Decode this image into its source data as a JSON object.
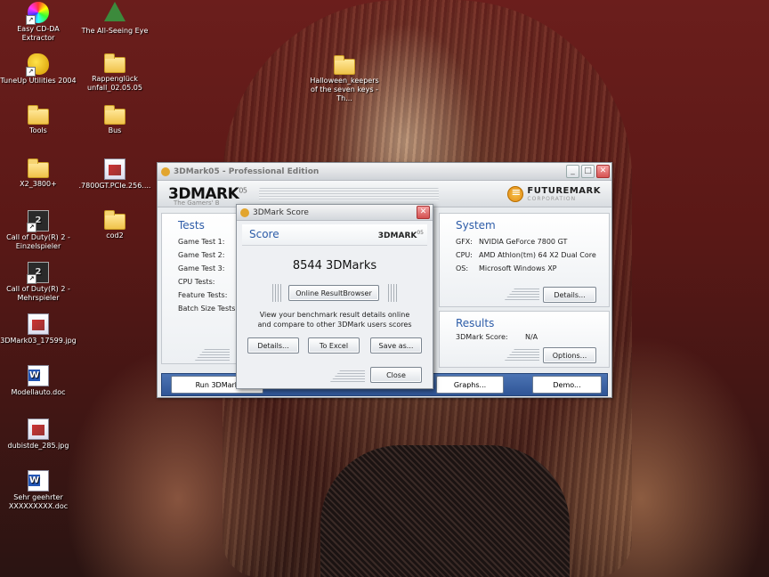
{
  "desktop": {
    "icons": [
      {
        "label": "Easy CD-DA Extractor",
        "icon": "cd-icon"
      },
      {
        "label": "The All-Seeing Eye",
        "icon": "eye-icon"
      },
      {
        "label": "TuneUp Utilities 2004",
        "icon": "tuneup-icon"
      },
      {
        "label": "Rappenglück unfall_02.05.05",
        "icon": "folder-icon"
      },
      {
        "label": "Tools",
        "icon": "folder-icon"
      },
      {
        "label": "Bus",
        "icon": "folder-icon"
      },
      {
        "label": "X2_3800+",
        "icon": "folder-icon"
      },
      {
        "label": ".7800GT.PCIe.256....",
        "icon": "file-icon"
      },
      {
        "label": "Call of Duty(R) 2 - Einzelspieler",
        "icon": "cod-icon"
      },
      {
        "label": "cod2",
        "icon": "folder-icon"
      },
      {
        "label": "Call of Duty(R) 2 - Mehrspieler",
        "icon": "cod-icon"
      },
      {
        "label": "3DMark03_17599.jpg",
        "icon": "image-icon"
      },
      {
        "label": "Modellauto.doc",
        "icon": "word-doc-icon"
      },
      {
        "label": "dubistde_285.jpg",
        "icon": "image-icon"
      },
      {
        "label": "Sehr geehrter XXXXXXXXX.doc",
        "icon": "word-doc-icon"
      },
      {
        "label": "Halloween_keepers of the seven keys -Th...",
        "icon": "folder-icon"
      }
    ]
  },
  "main_window": {
    "title": "3DMark05 - Professional Edition",
    "logo": "3DMARK",
    "logo_suffix": "05",
    "tagline": "The Gamers' B",
    "brand": "FUTUREMARK",
    "brand_sub": "CORPORATION",
    "tests": {
      "heading": "Tests",
      "items": [
        "Game Test 1:",
        "Game Test 2:",
        "Game Test 3:",
        "CPU Tests:",
        "Feature Tests:",
        "Batch Size Tests:"
      ]
    },
    "system": {
      "heading": "System",
      "rows": [
        {
          "key": "GFX:",
          "value": "NVIDIA GeForce 7800 GT"
        },
        {
          "key": "CPU:",
          "value": "AMD Athlon(tm) 64 X2 Dual Core"
        },
        {
          "key": "OS:",
          "value": "Microsoft Windows XP"
        }
      ],
      "details_label": "Details..."
    },
    "results": {
      "heading": "Results",
      "score_key": "3DMark Score:",
      "score_value": "N/A",
      "options_label": "Options..."
    },
    "bottom": {
      "run_label": "Run 3DMark",
      "graphs_label": "Graphs...",
      "demo_label": "Demo..."
    }
  },
  "score_dialog": {
    "title": "3DMark Score",
    "header": "Score",
    "logo": "3DMARK",
    "logo_suffix": "05",
    "score": "8544 3DMarks",
    "online_label": "Online ResultBrowser",
    "info_line1": "View your benchmark result details online",
    "info_line2": "and compare to other 3DMark users scores",
    "details_label": "Details...",
    "excel_label": "To Excel",
    "save_label": "Save as...",
    "close_label": "Close"
  }
}
